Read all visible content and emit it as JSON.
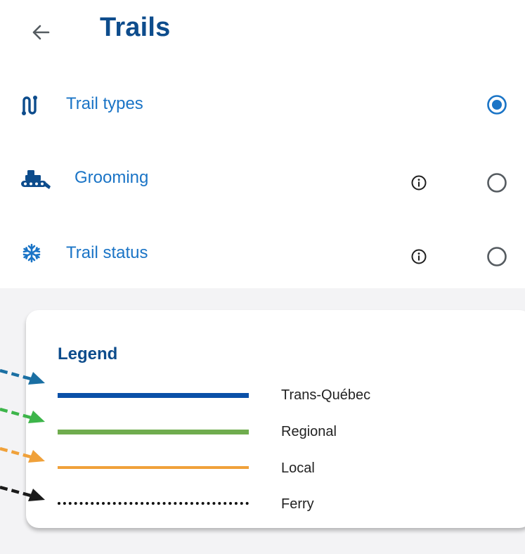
{
  "header": {
    "title": "Trails",
    "back_icon": "arrow-left-icon"
  },
  "layers": [
    {
      "label": "Trail types",
      "icon": "trail-route-icon",
      "has_info": false,
      "selected": true
    },
    {
      "label": "Grooming",
      "icon": "snow-groomer-icon",
      "has_info": true,
      "selected": false
    },
    {
      "label": "Trail status",
      "icon": "snowflake-icon",
      "has_info": true,
      "selected": false
    }
  ],
  "legend": {
    "title": "Legend",
    "items": [
      {
        "label": "Trans-Québec",
        "color": "#0a50a8",
        "style": "solid"
      },
      {
        "label": "Regional",
        "color": "#6fac4e",
        "style": "solid"
      },
      {
        "label": "Local",
        "color": "#f0a13a",
        "style": "solid"
      },
      {
        "label": "Ferry",
        "color": "#111111",
        "style": "dotted"
      }
    ]
  },
  "pointer_colors": [
    "#1a6fa3",
    "#3db54a",
    "#f0a13a",
    "#1a1a1a"
  ],
  "colors": {
    "accent": "#1a74c6",
    "title": "#0d4c8c",
    "radio_unselected": "#555b60"
  }
}
